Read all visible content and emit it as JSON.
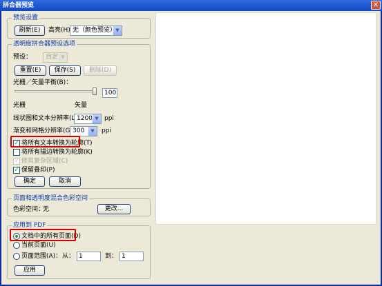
{
  "window": {
    "title": "拼合器预览",
    "close_glyph": "✕"
  },
  "preview_settings": {
    "group_title": "预览设置",
    "refresh_label": "刷新(E)",
    "highlight_label": "高亮(H)",
    "highlight_value": "无（颜色预览）"
  },
  "preset_options": {
    "group_title": "透明度拼合器预设选项",
    "preset_label": "预设：",
    "preset_value": "自定义",
    "reset_label": "重置(E)",
    "save_label": "保存(S)",
    "delete_label": "删除(D)",
    "balance_label": "光栅／矢量平衡(B)：",
    "balance_value": "100",
    "raster_label": "光栅",
    "vector_label": "矢量",
    "line_art_label": "线状图和文本分辨率(L)：",
    "line_art_value": "1200",
    "gradient_label": "渐变和网格分辨率(G)：",
    "gradient_value": "300",
    "ppi_unit": "ppi",
    "convert_text_label": "将所有文本转换为轮廓(T)",
    "convert_strokes_label": "将所有描边转换为轮廓(K)",
    "clip_regions_label": "修剪复杂区域(C)",
    "preserve_overprint_label": "保留叠印(P)",
    "ok_label": "确定",
    "cancel_label": "取消",
    "convert_text_checked": true,
    "convert_strokes_checked": false,
    "clip_regions_checked": true,
    "preserve_overprint_checked": true
  },
  "color_space": {
    "group_title": "页面和透明度混合色彩空间",
    "label": "色彩空间：",
    "value": "无",
    "change_label": "更改..."
  },
  "apply_pdf": {
    "group_title": "应用到 PDF",
    "all_pages_label": "文档中的所有页面(D)",
    "current_page_label": "当前页面(U)",
    "page_range_label": "页面范围(A)：",
    "from_label": "从：",
    "from_value": "1",
    "to_label": "到：",
    "to_value": "1",
    "apply_label": "应用",
    "selected": "all_pages"
  }
}
